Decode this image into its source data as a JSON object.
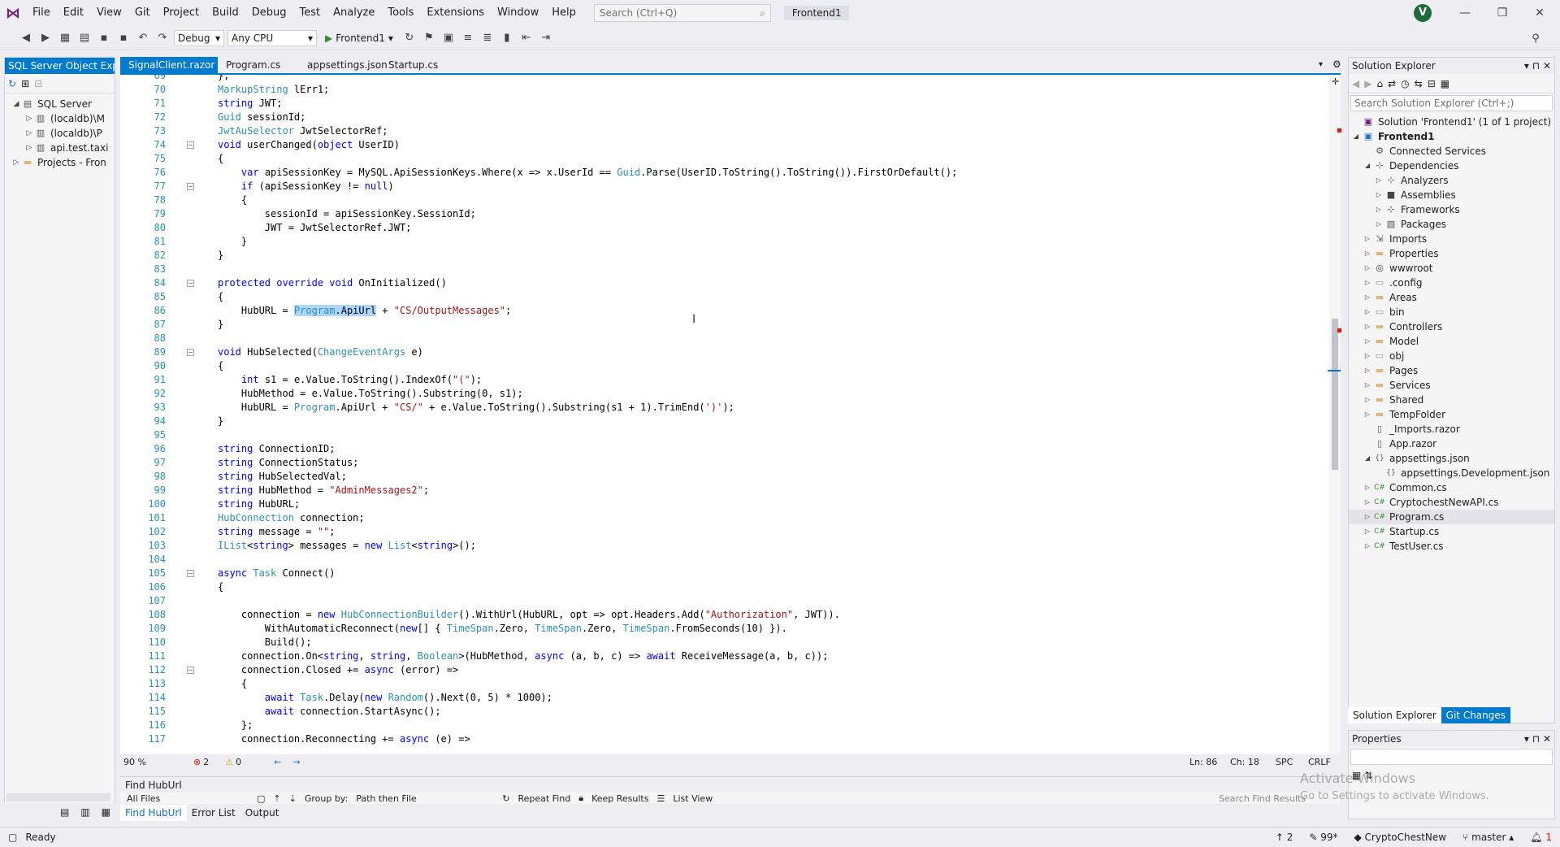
{
  "menu": [
    "File",
    "Edit",
    "View",
    "Git",
    "Project",
    "Build",
    "Debug",
    "Test",
    "Analyze",
    "Tools",
    "Extensions",
    "Window",
    "Help"
  ],
  "search": {
    "placeholder": "Search (Ctrl+Q)"
  },
  "solution_name": "Frontend1",
  "avatar_letter": "V",
  "toolbar": {
    "config": "Debug",
    "platform": "Any CPU",
    "run_target": "Frontend1"
  },
  "left_panel": {
    "title": "SQL Server Object Expl...",
    "items": [
      {
        "label": "SQL Server",
        "depth": 0
      },
      {
        "label": "(localdb)\\M",
        "depth": 1
      },
      {
        "label": "(localdb)\\P",
        "depth": 1
      },
      {
        "label": "api.test.taxi",
        "depth": 1
      },
      {
        "label": "Projects - Fron",
        "depth": 0
      }
    ]
  },
  "doc_tabs": [
    "SignalClient.razor",
    "Program.cs",
    "appsettings.json",
    "Startup.cs"
  ],
  "code_lines": [
    {
      "n": "69",
      "t": "};"
    },
    {
      "n": "70",
      "t": "MarkupString lErr1;"
    },
    {
      "n": "71",
      "t": "string JWT;"
    },
    {
      "n": "72",
      "t": "Guid sessionId;"
    },
    {
      "n": "73",
      "t": "JwtAuSelector JwtSelectorRef;"
    },
    {
      "n": "74",
      "t": "void userChanged(object UserID)"
    },
    {
      "n": "75",
      "t": "{"
    },
    {
      "n": "76",
      "t": "    var apiSessionKey = MySQL.ApiSessionKeys.Where(x => x.UserId == Guid.Parse(UserID.ToString().ToString()).FirstOrDefault();"
    },
    {
      "n": "77",
      "t": "    if (apiSessionKey != null)"
    },
    {
      "n": "78",
      "t": "    {"
    },
    {
      "n": "79",
      "t": "        sessionId = apiSessionKey.SessionId;"
    },
    {
      "n": "80",
      "t": "        JWT = JwtSelectorRef.JWT;"
    },
    {
      "n": "81",
      "t": "    }"
    },
    {
      "n": "82",
      "t": "}"
    },
    {
      "n": "83",
      "t": ""
    },
    {
      "n": "84",
      "t": "protected override void OnInitialized()"
    },
    {
      "n": "85",
      "t": "{"
    },
    {
      "n": "86",
      "t": "    HubURL = Program.ApiUrl + \"CS/OutputMessages\";"
    },
    {
      "n": "87",
      "t": "}"
    },
    {
      "n": "88",
      "t": ""
    },
    {
      "n": "89",
      "t": "void HubSelected(ChangeEventArgs e)"
    },
    {
      "n": "90",
      "t": "{"
    },
    {
      "n": "91",
      "t": "    int s1 = e.Value.ToString().IndexOf(\"(\");"
    },
    {
      "n": "92",
      "t": "    HubMethod = e.Value.ToString().Substring(0, s1);"
    },
    {
      "n": "93",
      "t": "    HubURL = Program.ApiUrl + \"CS/\" + e.Value.ToString().Substring(s1 + 1).TrimEnd(')');"
    },
    {
      "n": "94",
      "t": "}"
    },
    {
      "n": "95",
      "t": ""
    },
    {
      "n": "96",
      "t": "string ConnectionID;"
    },
    {
      "n": "97",
      "t": "string ConnectionStatus;"
    },
    {
      "n": "98",
      "t": "string HubSelectedVal;"
    },
    {
      "n": "99",
      "t": "string HubMethod = \"AdminMessages2\";"
    },
    {
      "n": "100",
      "t": "string HubURL;"
    },
    {
      "n": "101",
      "t": "HubConnection connection;"
    },
    {
      "n": "102",
      "t": "string message = \"\";"
    },
    {
      "n": "103",
      "t": "IList<string> messages = new List<string>();"
    },
    {
      "n": "104",
      "t": ""
    },
    {
      "n": "105",
      "t": "async Task Connect()"
    },
    {
      "n": "106",
      "t": "{"
    },
    {
      "n": "107",
      "t": ""
    },
    {
      "n": "108",
      "t": "    connection = new HubConnectionBuilder().WithUrl(HubURL, opt => opt.Headers.Add(\"Authorization\", JWT))."
    },
    {
      "n": "109",
      "t": "        WithAutomaticReconnect(new[] { TimeSpan.Zero, TimeSpan.Zero, TimeSpan.FromSeconds(10) })."
    },
    {
      "n": "110",
      "t": "        Build();"
    },
    {
      "n": "111",
      "t": "    connection.On<string, string, Boolean>(HubMethod, async (a, b, c) => await ReceiveMessage(a, b, c));"
    },
    {
      "n": "112",
      "t": "    connection.Closed += async (error) =>"
    },
    {
      "n": "113",
      "t": "    {"
    },
    {
      "n": "114",
      "t": "        await Task.Delay(new Random().Next(0, 5) * 1000);"
    },
    {
      "n": "115",
      "t": "        await connection.StartAsync();"
    },
    {
      "n": "116",
      "t": "    };"
    },
    {
      "n": "117",
      "t": "    connection.Reconnecting += async (e) =>"
    }
  ],
  "editor_status": {
    "zoom": "90 %",
    "errors": "2",
    "warnings": "0",
    "ln": "Ln: 86",
    "ch": "Ch: 18",
    "spc": "SPC",
    "crlf": "CRLF"
  },
  "find": {
    "title": "Find HubUrl",
    "scope": "All Files",
    "group_by_label": "Group by:",
    "group_by": "Path then File",
    "repeat": "Repeat Find",
    "keep": "Keep Results",
    "list_view": "List View",
    "search_placeholder": "Search Find Results"
  },
  "bottom_tabs": [
    "Find HubUrl",
    "Error List",
    "Output"
  ],
  "solution_explorer": {
    "title": "Solution Explorer",
    "search_placeholder": "Search Solution Explorer (Ctrl+;)",
    "items": [
      {
        "label": "Solution 'Frontend1' (1 of 1 project)",
        "depth": 0,
        "arrow": "",
        "icon": "sln"
      },
      {
        "label": "Frontend1",
        "depth": 0,
        "arrow": "down",
        "icon": "proj"
      },
      {
        "label": "Connected Services",
        "depth": 1,
        "arrow": "",
        "icon": "svc"
      },
      {
        "label": "Dependencies",
        "depth": 1,
        "arrow": "down",
        "icon": "dep"
      },
      {
        "label": "Analyzers",
        "depth": 2,
        "arrow": "right",
        "icon": "dep"
      },
      {
        "label": "Assemblies",
        "depth": 2,
        "arrow": "right",
        "icon": "asm"
      },
      {
        "label": "Frameworks",
        "depth": 2,
        "arrow": "right",
        "icon": "dep"
      },
      {
        "label": "Packages",
        "depth": 2,
        "arrow": "right",
        "icon": "pkg"
      },
      {
        "label": "Imports",
        "depth": 1,
        "arrow": "right",
        "icon": "imp"
      },
      {
        "label": "Properties",
        "depth": 1,
        "arrow": "right",
        "icon": "folder"
      },
      {
        "label": "wwwroot",
        "depth": 1,
        "arrow": "right",
        "icon": "web"
      },
      {
        "label": ".config",
        "depth": 1,
        "arrow": "right",
        "icon": "folder-empty"
      },
      {
        "label": "Areas",
        "depth": 1,
        "arrow": "right",
        "icon": "folder"
      },
      {
        "label": "bin",
        "depth": 1,
        "arrow": "right",
        "icon": "folder-empty"
      },
      {
        "label": "Controllers",
        "depth": 1,
        "arrow": "right",
        "icon": "folder"
      },
      {
        "label": "Model",
        "depth": 1,
        "arrow": "right",
        "icon": "folder"
      },
      {
        "label": "obj",
        "depth": 1,
        "arrow": "right",
        "icon": "folder-empty"
      },
      {
        "label": "Pages",
        "depth": 1,
        "arrow": "right",
        "icon": "folder"
      },
      {
        "label": "Services",
        "depth": 1,
        "arrow": "right",
        "icon": "folder"
      },
      {
        "label": "Shared",
        "depth": 1,
        "arrow": "right",
        "icon": "folder"
      },
      {
        "label": "TempFolder",
        "depth": 1,
        "arrow": "right",
        "icon": "folder"
      },
      {
        "label": "_Imports.razor",
        "depth": 1,
        "arrow": "",
        "icon": "razor"
      },
      {
        "label": "App.razor",
        "depth": 1,
        "arrow": "",
        "icon": "razor"
      },
      {
        "label": "appsettings.json",
        "depth": 1,
        "arrow": "down",
        "icon": "json"
      },
      {
        "label": "appsettings.Development.json",
        "depth": 2,
        "arrow": "",
        "icon": "json"
      },
      {
        "label": "Common.cs",
        "depth": 1,
        "arrow": "right",
        "icon": "cs"
      },
      {
        "label": "CryptochestNewAPI.cs",
        "depth": 1,
        "arrow": "right",
        "icon": "cs"
      },
      {
        "label": "Program.cs",
        "depth": 1,
        "arrow": "right",
        "icon": "cs",
        "selected": true
      },
      {
        "label": "Startup.cs",
        "depth": 1,
        "arrow": "right",
        "icon": "cs"
      },
      {
        "label": "TestUser.cs",
        "depth": 1,
        "arrow": "right",
        "icon": "cs"
      }
    ]
  },
  "sol_tabs": [
    "Solution Explorer",
    "Git Changes"
  ],
  "properties_title": "Properties",
  "watermark": {
    "line1": "Activate Windows",
    "line2": "Go to Settings to activate Windows."
  },
  "statusbar": {
    "ready": "Ready",
    "up": "2",
    "edits": "99*",
    "repo": "CryptoChestNew",
    "branch": "master",
    "notif": "1"
  }
}
